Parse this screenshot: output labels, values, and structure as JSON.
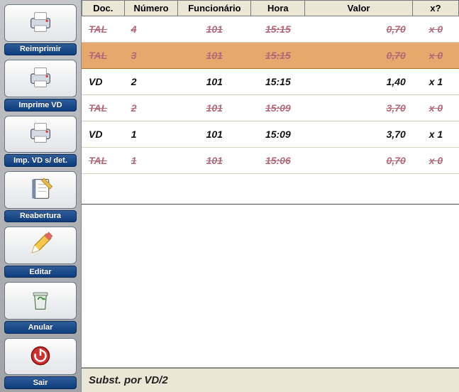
{
  "sidebar": [
    {
      "name": "reimprimir",
      "label": "Reimprimir",
      "icon": "printer"
    },
    {
      "name": "imprime-vd",
      "label": "Imprime VD",
      "icon": "printer"
    },
    {
      "name": "imp-vd-sdet",
      "label": "Imp. VD s/ det.",
      "icon": "printer"
    },
    {
      "name": "reabertura",
      "label": "Reabertura",
      "icon": "notebook"
    },
    {
      "name": "editar",
      "label": "Editar",
      "icon": "pencil"
    },
    {
      "name": "anular",
      "label": "Anular",
      "icon": "recycle"
    },
    {
      "name": "sair",
      "label": "Sair",
      "icon": "power"
    }
  ],
  "columns": {
    "doc": "Doc.",
    "numero": "Número",
    "funcionario": "Funcionário",
    "hora": "Hora",
    "valor": "Valor",
    "x": "x?"
  },
  "rows": [
    {
      "doc": "TAL",
      "numero": "4",
      "func": "101",
      "hora": "15:15",
      "valor": "0,70",
      "x": "x 0",
      "cancelled": true,
      "selected": false
    },
    {
      "doc": "TAL",
      "numero": "3",
      "func": "101",
      "hora": "15:15",
      "valor": "0,70",
      "x": "x 0",
      "cancelled": true,
      "selected": true
    },
    {
      "doc": "VD",
      "numero": "2",
      "func": "101",
      "hora": "15:15",
      "valor": "1,40",
      "x": "x 1",
      "cancelled": false,
      "selected": false
    },
    {
      "doc": "TAL",
      "numero": "2",
      "func": "101",
      "hora": "15:09",
      "valor": "3,70",
      "x": "x 0",
      "cancelled": true,
      "selected": false
    },
    {
      "doc": "VD",
      "numero": "1",
      "func": "101",
      "hora": "15:09",
      "valor": "3,70",
      "x": "x 1",
      "cancelled": false,
      "selected": false
    },
    {
      "doc": "TAL",
      "numero": "1",
      "func": "101",
      "hora": "15:06",
      "valor": "0,70",
      "x": "x 0",
      "cancelled": true,
      "selected": false
    }
  ],
  "status": "Subst. por VD/2"
}
